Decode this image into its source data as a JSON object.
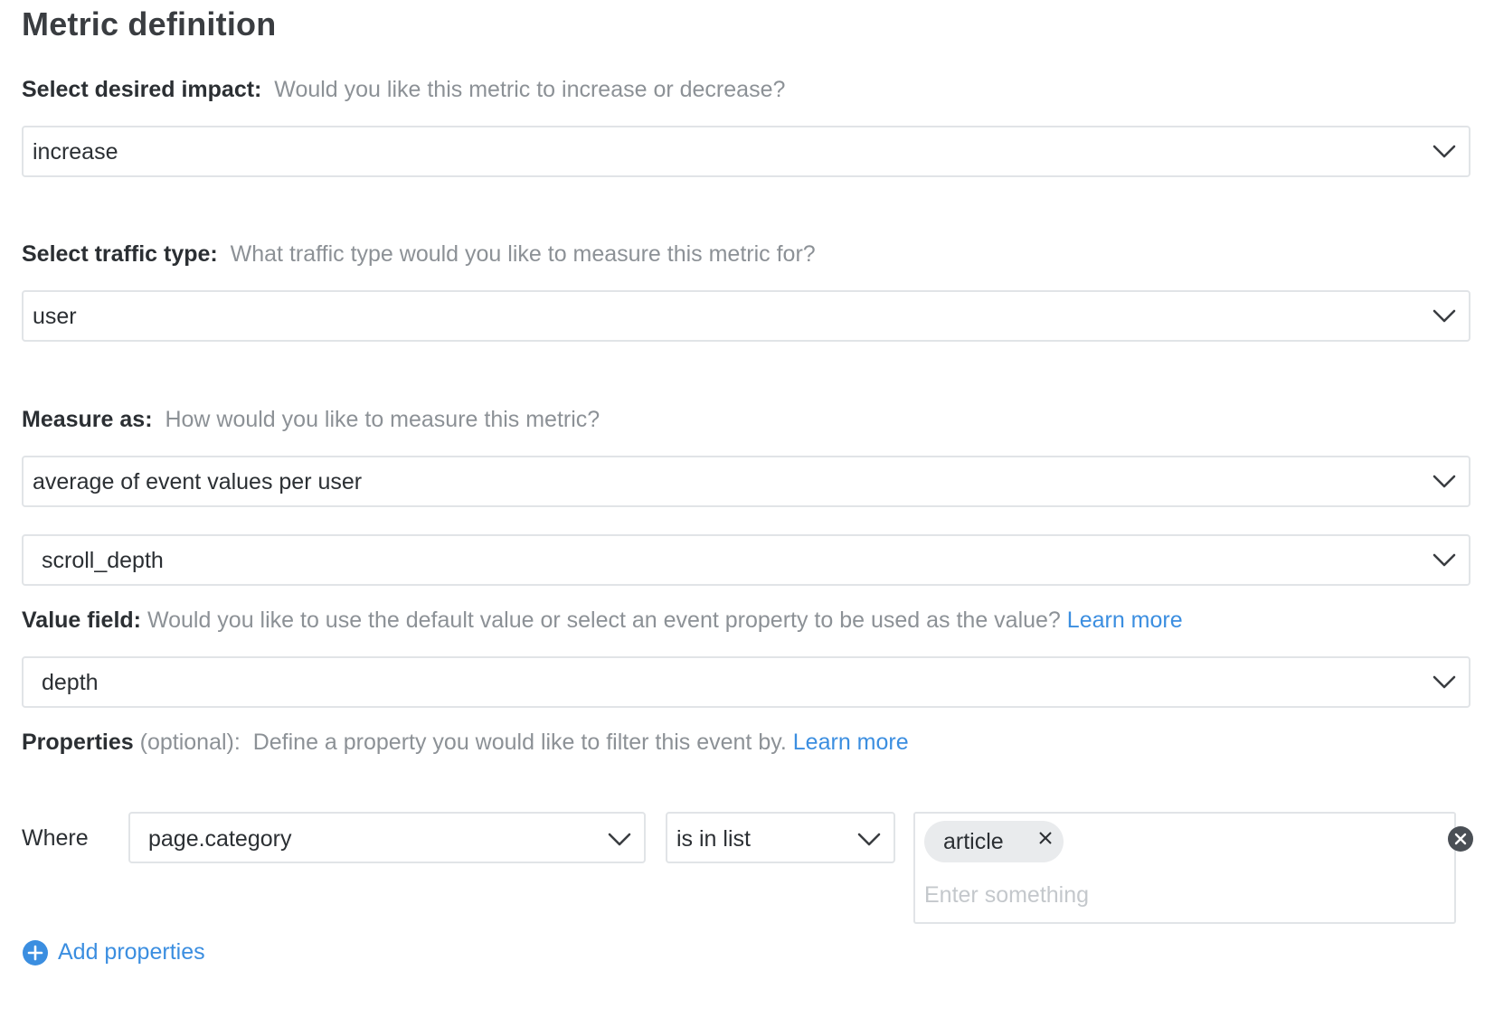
{
  "section": {
    "title": "Metric definition"
  },
  "impact": {
    "label": "Select desired impact:",
    "hint": "Would you like this metric to increase or decrease?",
    "value": "increase"
  },
  "traffic": {
    "label": "Select traffic type:",
    "hint": "What traffic type would you like to measure this metric for?",
    "value": "user"
  },
  "measure": {
    "label": "Measure as:",
    "hint": "How would you like to measure this metric?",
    "value": "average of event values per user",
    "event_value": "scroll_depth"
  },
  "value_field": {
    "label": "Value field:",
    "hint": "Would you like to use the default value or select an event property to be used as the value?",
    "link": "Learn more",
    "value": "depth"
  },
  "properties": {
    "label": "Properties",
    "optional": "(optional):",
    "hint": "Define a property you would like to filter this event by.",
    "link": "Learn more",
    "where_label": "Where",
    "property_value": "page.category",
    "operator_value": "is in list",
    "chips": [
      "article"
    ],
    "input_placeholder": "Enter something",
    "add_label": "Add properties"
  },
  "colors": {
    "link": "#3b8ee0",
    "border": "#e1e4e7",
    "hint": "#8c9196",
    "chip": "#e9ebed",
    "remove": "#4a4f55"
  },
  "icons": {
    "dropdown": "chevron-down-icon",
    "chip_remove": "close-icon",
    "row_remove": "remove-circle-icon",
    "add": "plus-circle-icon"
  }
}
